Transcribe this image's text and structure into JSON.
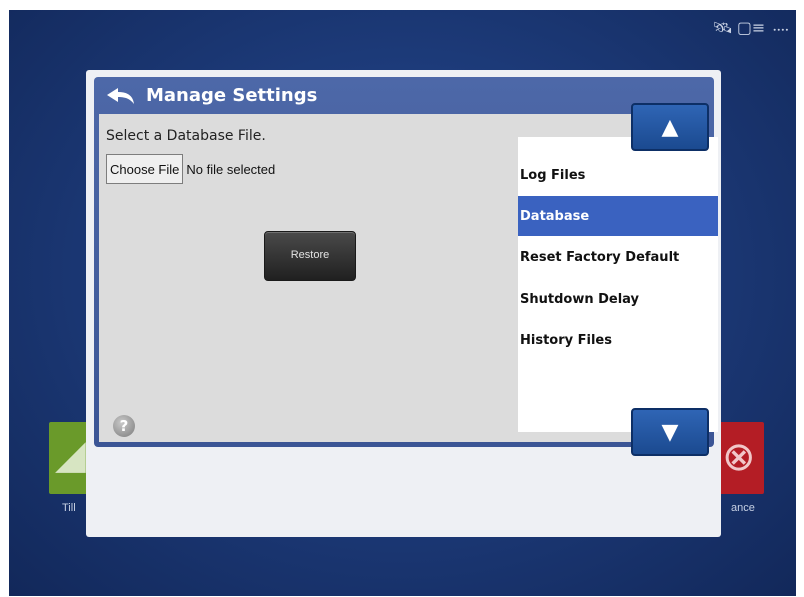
{
  "status_bar": {
    "icons": [
      "gps-satellite-icon",
      "display-icon",
      "signal-icon"
    ],
    "glyphs": {
      "gps": "🛰",
      "display": "▢≡",
      "signal": "᠁"
    }
  },
  "background_tiles": {
    "left": {
      "caption": "Till",
      "color": "#6a9a2a",
      "glyph": "◢"
    },
    "right": {
      "caption": "ance",
      "color": "#b41d25",
      "glyph": "⊗"
    }
  },
  "dialog": {
    "title": "Manage Settings",
    "select_label": "Select a Database File.",
    "choose_file_label": "Choose File",
    "file_status": "No file selected",
    "restore_label": "Restore",
    "help_glyph": "?",
    "menu": {
      "items": [
        {
          "label": "Log Files",
          "selected": false
        },
        {
          "label": "Database",
          "selected": true
        },
        {
          "label": "Reset Factory Default",
          "selected": false
        },
        {
          "label": "Shutdown Delay",
          "selected": false
        },
        {
          "label": "History Files",
          "selected": false
        }
      ]
    },
    "scroll_up_glyph": "▲",
    "scroll_down_glyph": "▼"
  },
  "colors": {
    "accent": "#3a62c0",
    "frame": "#4d68a8",
    "background": "#1d3b7a"
  }
}
